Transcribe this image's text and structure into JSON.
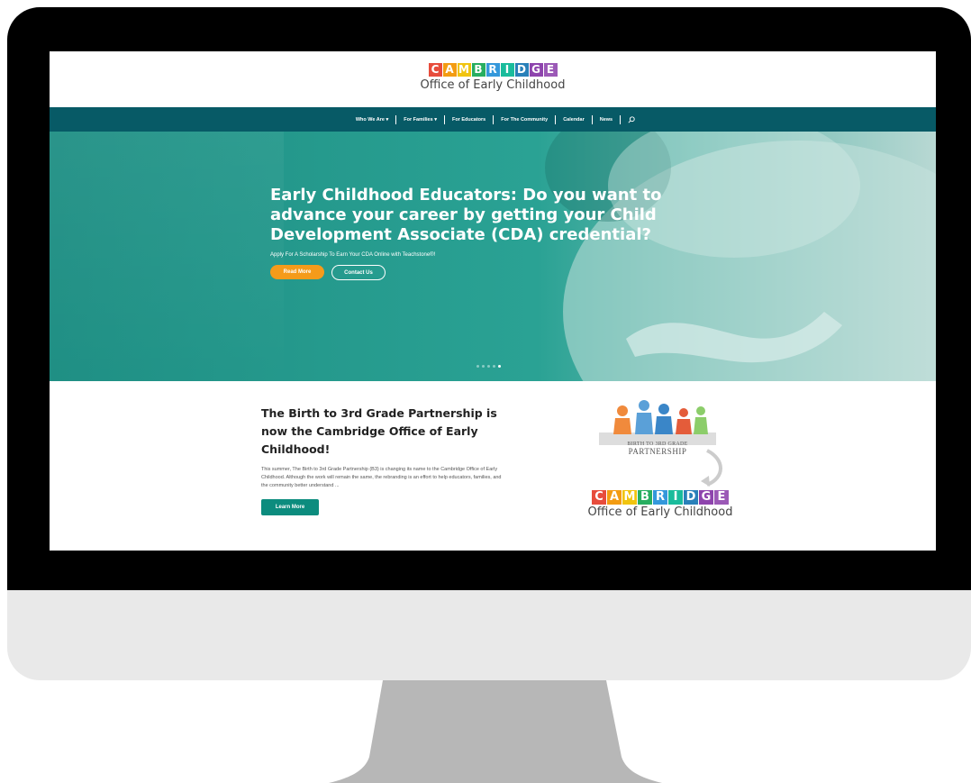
{
  "logo": {
    "letters": [
      {
        "char": "C",
        "color": "#e74c3c"
      },
      {
        "char": "A",
        "color": "#f39c12"
      },
      {
        "char": "M",
        "color": "#f1c40f"
      },
      {
        "char": "B",
        "color": "#27ae60"
      },
      {
        "char": "R",
        "color": "#3498db"
      },
      {
        "char": "I",
        "color": "#1abc9c"
      },
      {
        "char": "D",
        "color": "#2980b9"
      },
      {
        "char": "G",
        "color": "#8e44ad"
      },
      {
        "char": "E",
        "color": "#9b59b6"
      }
    ],
    "subtitle": "Office of Early Childhood"
  },
  "nav": {
    "items": [
      "Who We Are",
      "For Families",
      "For Educators",
      "For The Community",
      "Calendar",
      "News"
    ],
    "dropdown_marker": "▾"
  },
  "hero": {
    "title": "Early Childhood Educators: Do you want to advance your career by getting your Child Development Associate (CDA) credential?",
    "subtitle": "Apply For A Scholarship To Earn Your CDA Online with Teachstone®!",
    "read_more": "Read More",
    "contact_us": "Contact Us",
    "slides": 5,
    "active_slide": 5
  },
  "news": {
    "title": "The Birth to 3rd Grade Partnership is now the Cambridge Office of Early Childhood!",
    "body": "This summer, The Birth to 3rd Grade Partnership (B3) is changing its name to the Cambridge Office of Early Childhood. Although the work will remain the same, the rebranding is an effort to help educators, families, and the community better understand ...",
    "learn_more": "Learn More"
  },
  "b3_logo": {
    "line1": "BIRTH TO 3RD GRADE",
    "line2": "PARTNERSHIP"
  },
  "colors": {
    "nav": "#075a66",
    "hero": "#2a9d8f",
    "accent": "#f59b1a",
    "learn": "#0c8c7e"
  }
}
